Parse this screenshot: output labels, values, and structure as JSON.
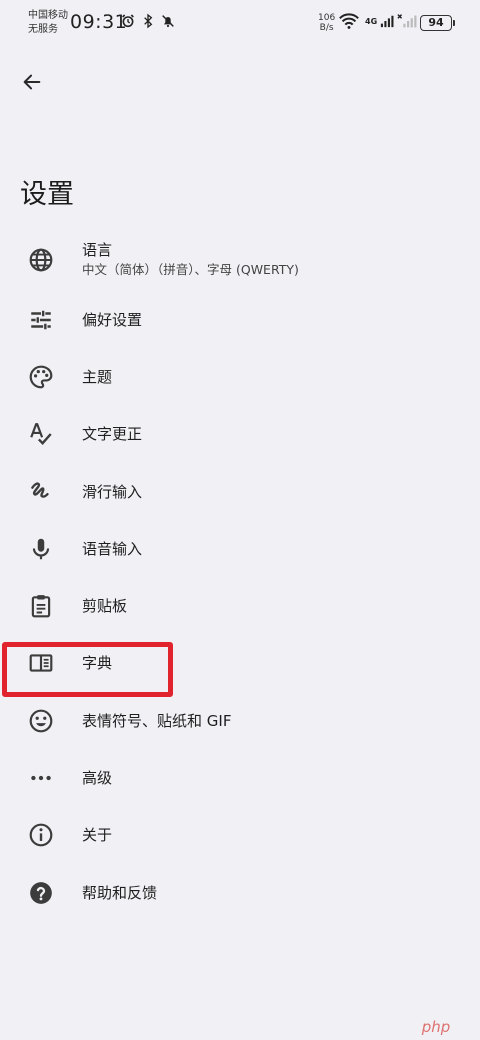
{
  "status_bar": {
    "carrier_line1": "中国移动",
    "carrier_line2": "无服务",
    "time": "09:31",
    "net_speed_value": "106",
    "net_speed_unit": "B/s",
    "network_type": "4G",
    "battery": "94",
    "icons": [
      "alarm-icon",
      "bluetooth-icon",
      "mute-icon",
      "wifi-icon",
      "signal-icon",
      "no-signal-icon"
    ]
  },
  "header": {
    "back_icon": "arrow-left-icon",
    "title": "设置"
  },
  "settings": {
    "items": [
      {
        "label": "语言",
        "sub": "中文（简体）（拼音）、字母 (QWERTY)",
        "icon": "globe-icon"
      },
      {
        "label": "偏好设置",
        "icon": "sliders-icon"
      },
      {
        "label": "主题",
        "icon": "palette-icon"
      },
      {
        "label": "文字更正",
        "icon": "spellcheck-icon"
      },
      {
        "label": "滑行输入",
        "icon": "gesture-icon"
      },
      {
        "label": "语音输入",
        "icon": "microphone-icon"
      },
      {
        "label": "剪贴板",
        "icon": "clipboard-icon"
      },
      {
        "label": "字典",
        "icon": "book-icon"
      },
      {
        "label": "表情符号、贴纸和 GIF",
        "icon": "emoji-icon"
      },
      {
        "label": "高级",
        "icon": "more-horizontal-icon"
      },
      {
        "label": "关于",
        "icon": "info-icon"
      },
      {
        "label": "帮助和反馈",
        "icon": "help-icon"
      }
    ]
  },
  "watermark": "php",
  "colors": {
    "background": "#f1f0f5",
    "highlight": "#e0232d",
    "icon": "#3c3c3c"
  }
}
